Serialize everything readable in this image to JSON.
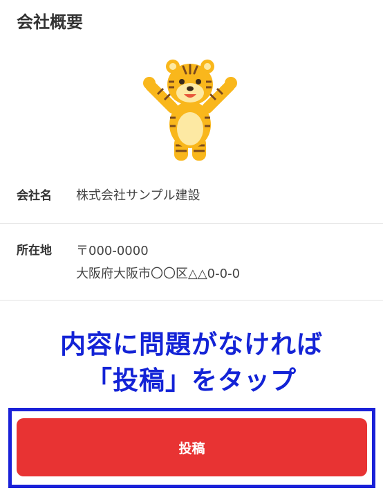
{
  "section": {
    "title": "会社概要"
  },
  "logo": {
    "icon": "tiger-mascot-icon",
    "colors": {
      "body": "#f9b71c",
      "belly": "#fde9a3",
      "stripe": "#7a4a1e",
      "mouth": "#e8573b"
    }
  },
  "company_info": {
    "name_label": "会社名",
    "name_value": "株式会社サンプル建設",
    "address_label": "所在地",
    "postal_code": "〒000-0000",
    "address": "大阪府大阪市〇〇区△△0-0-0"
  },
  "instruction": {
    "line1": "内容に問題がなければ",
    "line2": "「投稿」をタップ",
    "color": "#1323d6"
  },
  "post_button": {
    "label": "投稿",
    "color": "#e83333"
  },
  "highlight": {
    "color": "#1a21d8"
  }
}
